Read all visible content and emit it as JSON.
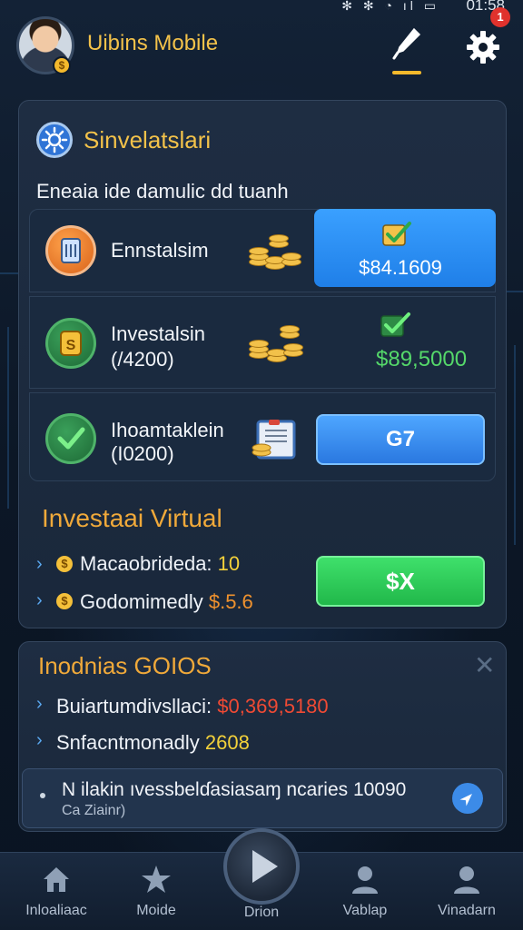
{
  "status_bar": {
    "time": "01:58",
    "icons": "✻ ✻ ◔ ıl ▭"
  },
  "header": {
    "title": "Uibins Mobile",
    "avatar_badge": "$",
    "notification_count": "1"
  },
  "main_card": {
    "title": "Sinvelatslari",
    "subtitle": "Eneaia ide damulic dd tuanh",
    "rows": [
      {
        "label": "Ennstalsim",
        "value": "$84.1609"
      },
      {
        "label": "Investalsin",
        "label2": "(/4200)",
        "value": "$89,5000"
      },
      {
        "label": "Ihoamtaklein",
        "label2": "(I0200)",
        "button": "G7"
      }
    ],
    "virtual": {
      "title": "Investaai Virtual",
      "items": [
        {
          "label": "Macaobrideda:",
          "value": "10"
        },
        {
          "label": "Godomimedly",
          "value": "$.5.6"
        }
      ],
      "button": "$X"
    }
  },
  "second_card": {
    "title": "Inodnias GOIOS",
    "items": [
      {
        "label": "Buiartumdivsllaci:",
        "value": "$0,369,5180"
      },
      {
        "label": "Snfacntmonadly",
        "value": "2608"
      }
    ],
    "note": {
      "text": "N ilakin ıvessbelɗasiasaɱ ncaries 10090",
      "sub": "Ca Ziainr)"
    }
  },
  "nav": {
    "items": [
      {
        "label": "Inloaliaac",
        "icon": "home-icon"
      },
      {
        "label": "Moide",
        "icon": "star-icon"
      },
      {
        "label": "Drion",
        "icon": "play-icon"
      },
      {
        "label": "Vablap",
        "icon": "user-icon"
      },
      {
        "label": "Vinadarn",
        "icon": "user-icon"
      }
    ]
  },
  "colors": {
    "accent_gold": "#f3c24a",
    "accent_blue": "#2f86f0",
    "accent_green": "#2fcf5a",
    "background": "#0e1a2b"
  }
}
